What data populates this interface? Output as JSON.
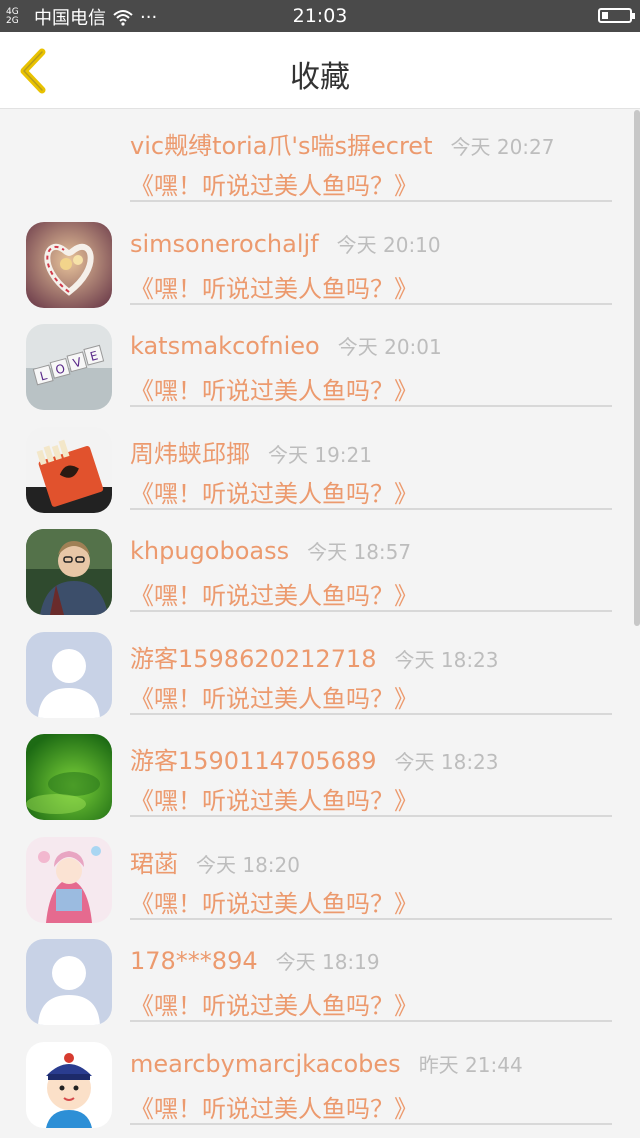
{
  "status_bar": {
    "signal": "4G 2G",
    "carrier": "中国电信",
    "wifi_icon": "wifi-icon",
    "more": "···",
    "time": "21:03"
  },
  "header": {
    "back_icon": "chevron-left-icon",
    "title": "收藏"
  },
  "colors": {
    "accent": "#ec9a6e",
    "back_arrow": "#e9c200",
    "time": "#bdbdbd"
  },
  "items": [
    {
      "name": "vic觍缚toria爪's喘s摒ecret",
      "time": "今天 20:27",
      "message": "《嘿！听说过美人鱼吗？》",
      "avatar": "none"
    },
    {
      "name": "simsonerochaljf",
      "time": "今天 20:10",
      "message": "《嘿！听说过美人鱼吗？》",
      "avatar": "candy-heart"
    },
    {
      "name": "katsmakcofnieo",
      "time": "今天 20:01",
      "message": "《嘿！听说过美人鱼吗？》",
      "avatar": "love-blocks"
    },
    {
      "name": "周炜蛱邱揶",
      "time": "今天 19:21",
      "message": "《嘿！听说过美人鱼吗？》",
      "avatar": "cigarette-pack"
    },
    {
      "name": "khpugoboass",
      "time": "今天 18:57",
      "message": "《嘿！听说过美人鱼吗？》",
      "avatar": "man-photo"
    },
    {
      "name": "游客1598620212718",
      "time": "今天 18:23",
      "message": "《嘿！听说过美人鱼吗？》",
      "avatar": "default-user"
    },
    {
      "name": "游客1590114705689",
      "time": "今天 18:23",
      "message": "《嘿！听说过美人鱼吗？》",
      "avatar": "green-grass"
    },
    {
      "name": "珺菡",
      "time": "今天 18:20",
      "message": "《嘿！听说过美人鱼吗？》",
      "avatar": "anime-girl"
    },
    {
      "name": "178***894",
      "time": "今天 18:19",
      "message": "《嘿！听说过美人鱼吗？》",
      "avatar": "default-user"
    },
    {
      "name": "mearcbymarcjkacobes",
      "time": "昨天 21:44",
      "message": "《嘿！听说过美人鱼吗？》",
      "avatar": "cartoon-figure"
    }
  ]
}
